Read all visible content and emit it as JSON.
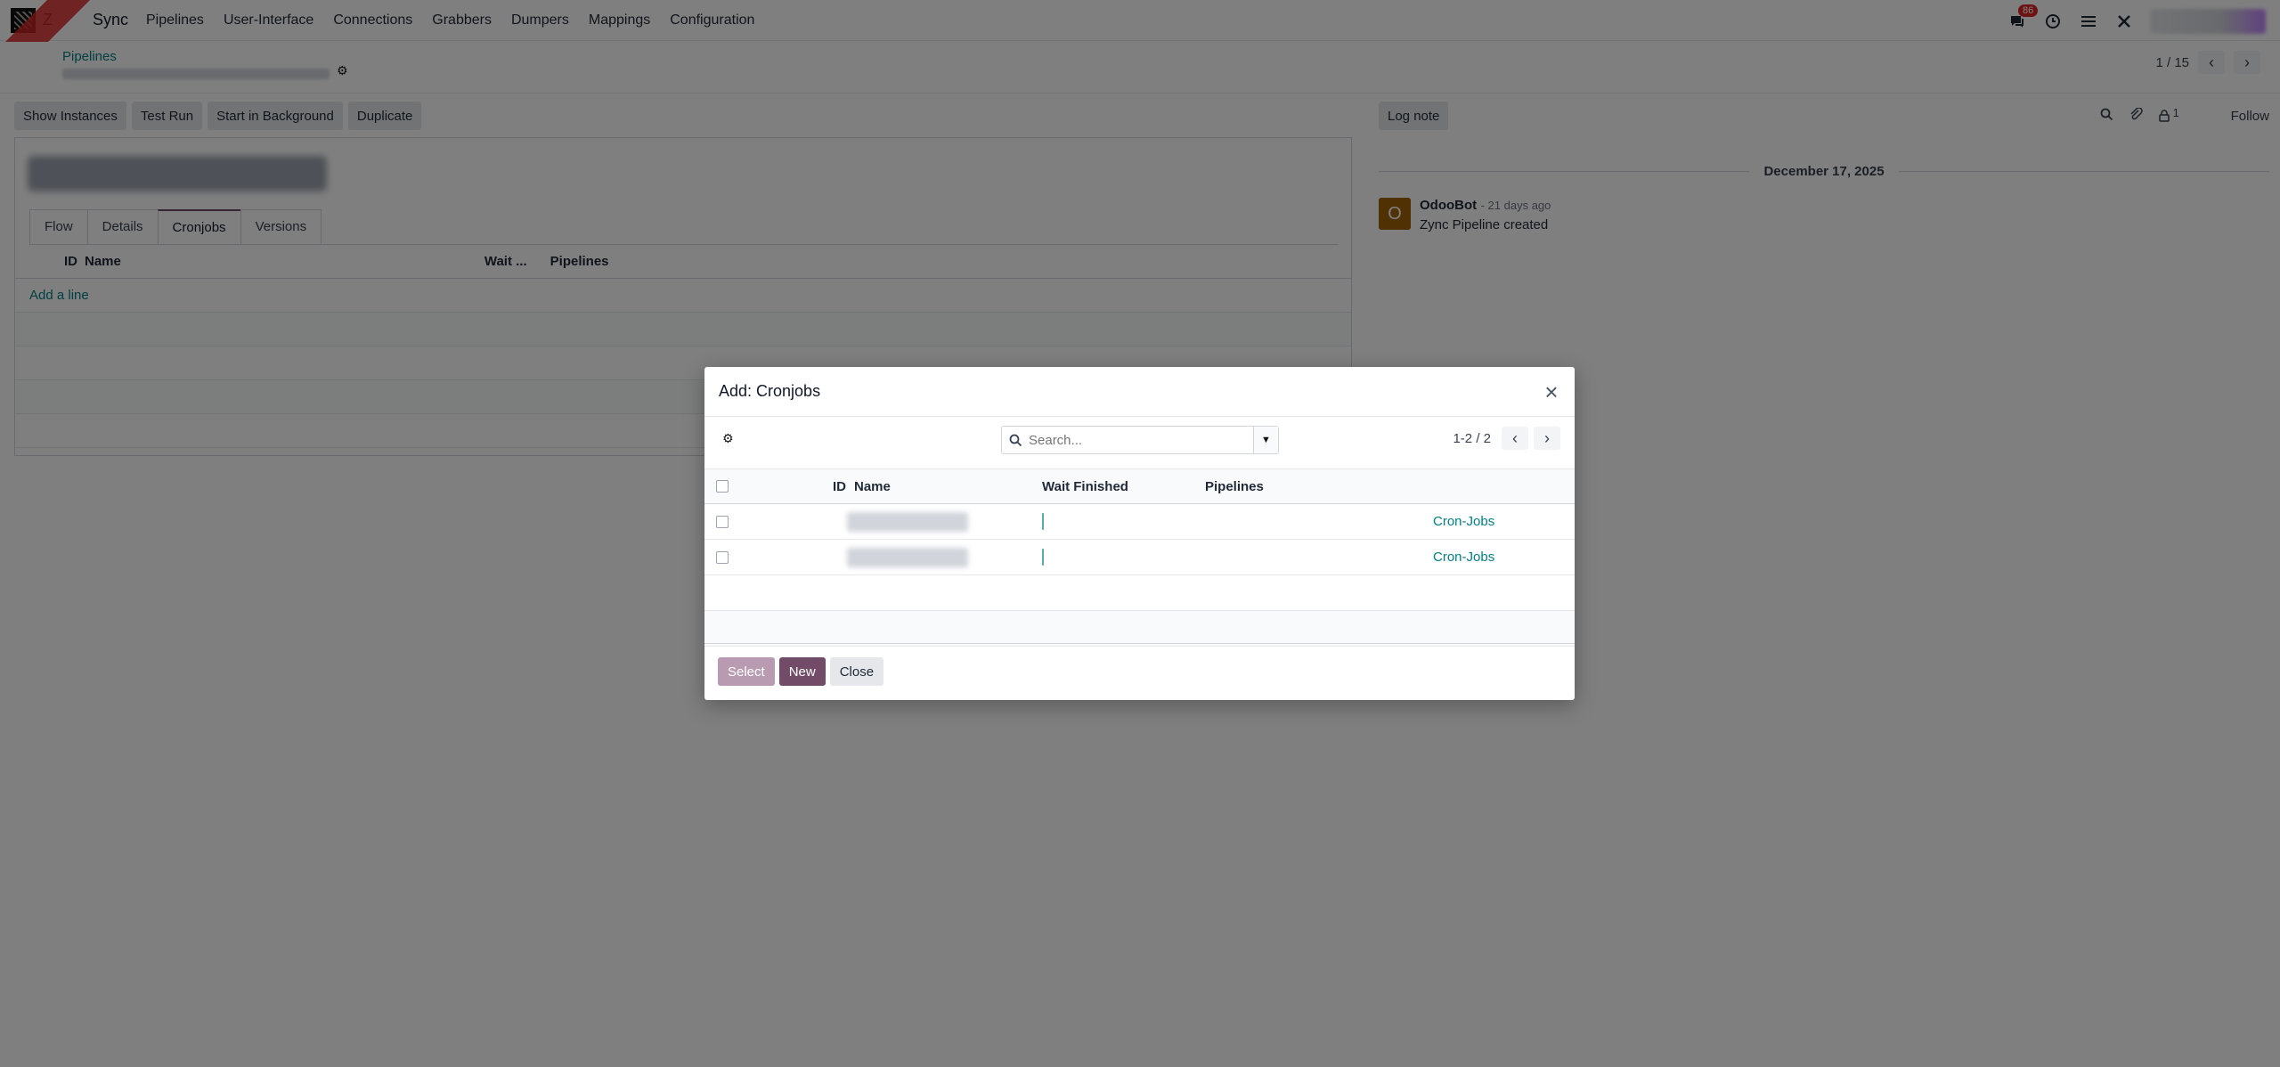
{
  "app": {
    "name_stub": "Z",
    "name": "Sync",
    "menu": [
      "Pipelines",
      "User-Interface",
      "Connections",
      "Grabbers",
      "Dumpers",
      "Mappings",
      "Configuration"
    ],
    "messages_badge": "86"
  },
  "control": {
    "breadcrumb": "Pipelines",
    "pager": "1 / 15"
  },
  "actions": [
    "Show Instances",
    "Test Run",
    "Start in Background",
    "Duplicate"
  ],
  "form": {
    "tabs": [
      "Flow",
      "Details",
      "Cronjobs",
      "Versions"
    ],
    "active_tab": "Cronjobs",
    "columns": {
      "id": "ID",
      "name": "Name",
      "wait": "Wait ...",
      "pipelines": "Pipelines"
    },
    "add_line": "Add a line"
  },
  "chatter": {
    "log_note": "Log note",
    "follow": "Follow",
    "attachments_count": "1",
    "date": "December 17, 2025",
    "author": "OdooBot",
    "avatar_letter": "O",
    "time": "- 21 days ago",
    "body": "Zync Pipeline created"
  },
  "modal": {
    "title": "Add: Cronjobs",
    "search_placeholder": "Search...",
    "pager": "1-2 / 2",
    "columns": {
      "id": "ID",
      "name": "Name",
      "wait": "Wait Finished",
      "pipelines": "Pipelines"
    },
    "rows": [
      {
        "wait_finished": true,
        "tag": "Cron-Jobs"
      },
      {
        "wait_finished": true,
        "tag": "Cron-Jobs"
      }
    ],
    "buttons": {
      "select": "Select",
      "new": "New",
      "close": "Close"
    }
  },
  "colors": {
    "primary": "#714b67",
    "link": "#017e84",
    "badge": "#dc2626"
  }
}
